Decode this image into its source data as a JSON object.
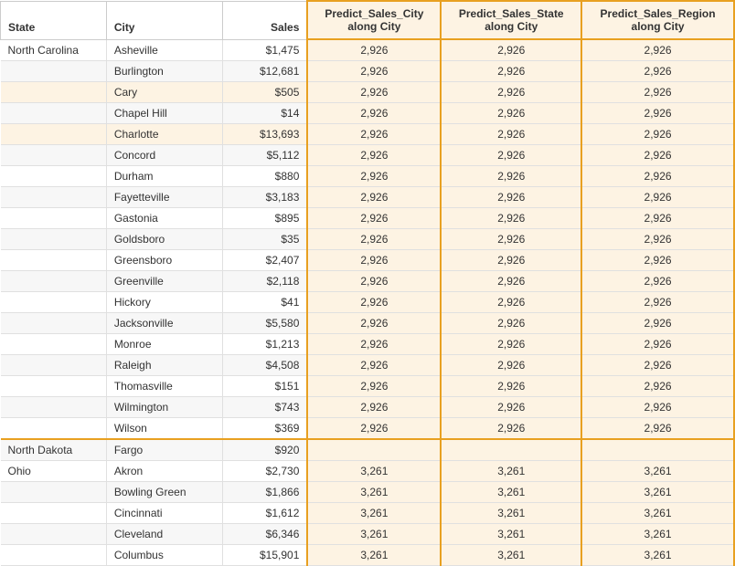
{
  "columns": [
    {
      "key": "state",
      "label": "State"
    },
    {
      "key": "city",
      "label": "City"
    },
    {
      "key": "sales",
      "label": "Sales"
    },
    {
      "key": "predict_city",
      "label": "Predict_Sales_City\nalong City"
    },
    {
      "key": "predict_state",
      "label": "Predict_Sales_State\nalong City"
    },
    {
      "key": "predict_region",
      "label": "Predict_Sales_Region\nalong City"
    }
  ],
  "rows": [
    {
      "state": "North Carolina",
      "city": "Asheville",
      "sales": "$1,475",
      "predict_city": "2,926",
      "predict_state": "2,926",
      "predict_region": "2,926",
      "group": "NC",
      "first": true
    },
    {
      "state": "",
      "city": "Burlington",
      "sales": "$12,681",
      "predict_city": "2,926",
      "predict_state": "2,926",
      "predict_region": "2,926",
      "group": "NC"
    },
    {
      "state": "",
      "city": "Cary",
      "sales": "$505",
      "predict_city": "2,926",
      "predict_state": "2,926",
      "predict_region": "2,926",
      "group": "NC",
      "highlight": true
    },
    {
      "state": "",
      "city": "Chapel Hill",
      "sales": "$14",
      "predict_city": "2,926",
      "predict_state": "2,926",
      "predict_region": "2,926",
      "group": "NC"
    },
    {
      "state": "",
      "city": "Charlotte",
      "sales": "$13,693",
      "predict_city": "2,926",
      "predict_state": "2,926",
      "predict_region": "2,926",
      "group": "NC",
      "highlight": true
    },
    {
      "state": "",
      "city": "Concord",
      "sales": "$5,112",
      "predict_city": "2,926",
      "predict_state": "2,926",
      "predict_region": "2,926",
      "group": "NC"
    },
    {
      "state": "",
      "city": "Durham",
      "sales": "$880",
      "predict_city": "2,926",
      "predict_state": "2,926",
      "predict_region": "2,926",
      "group": "NC"
    },
    {
      "state": "",
      "city": "Fayetteville",
      "sales": "$3,183",
      "predict_city": "2,926",
      "predict_state": "2,926",
      "predict_region": "2,926",
      "group": "NC"
    },
    {
      "state": "",
      "city": "Gastonia",
      "sales": "$895",
      "predict_city": "2,926",
      "predict_state": "2,926",
      "predict_region": "2,926",
      "group": "NC"
    },
    {
      "state": "",
      "city": "Goldsboro",
      "sales": "$35",
      "predict_city": "2,926",
      "predict_state": "2,926",
      "predict_region": "2,926",
      "group": "NC"
    },
    {
      "state": "",
      "city": "Greensboro",
      "sales": "$2,407",
      "predict_city": "2,926",
      "predict_state": "2,926",
      "predict_region": "2,926",
      "group": "NC"
    },
    {
      "state": "",
      "city": "Greenville",
      "sales": "$2,118",
      "predict_city": "2,926",
      "predict_state": "2,926",
      "predict_region": "2,926",
      "group": "NC"
    },
    {
      "state": "",
      "city": "Hickory",
      "sales": "$41",
      "predict_city": "2,926",
      "predict_state": "2,926",
      "predict_region": "2,926",
      "group": "NC"
    },
    {
      "state": "",
      "city": "Jacksonville",
      "sales": "$5,580",
      "predict_city": "2,926",
      "predict_state": "2,926",
      "predict_region": "2,926",
      "group": "NC"
    },
    {
      "state": "",
      "city": "Monroe",
      "sales": "$1,213",
      "predict_city": "2,926",
      "predict_state": "2,926",
      "predict_region": "2,926",
      "group": "NC"
    },
    {
      "state": "",
      "city": "Raleigh",
      "sales": "$4,508",
      "predict_city": "2,926",
      "predict_state": "2,926",
      "predict_region": "2,926",
      "group": "NC"
    },
    {
      "state": "",
      "city": "Thomasville",
      "sales": "$151",
      "predict_city": "2,926",
      "predict_state": "2,926",
      "predict_region": "2,926",
      "group": "NC"
    },
    {
      "state": "",
      "city": "Wilmington",
      "sales": "$743",
      "predict_city": "2,926",
      "predict_state": "2,926",
      "predict_region": "2,926",
      "group": "NC"
    },
    {
      "state": "",
      "city": "Wilson",
      "sales": "$369",
      "predict_city": "2,926",
      "predict_state": "2,926",
      "predict_region": "2,926",
      "group": "NC",
      "last": true
    },
    {
      "state": "North Dakota",
      "city": "Fargo",
      "sales": "$920",
      "predict_city": "",
      "predict_state": "",
      "predict_region": "",
      "group": "ND"
    },
    {
      "state": "Ohio",
      "city": "Akron",
      "sales": "$2,730",
      "predict_city": "3,261",
      "predict_state": "3,261",
      "predict_region": "3,261",
      "group": "OH"
    },
    {
      "state": "",
      "city": "Bowling Green",
      "sales": "$1,866",
      "predict_city": "3,261",
      "predict_state": "3,261",
      "predict_region": "3,261",
      "group": "OH"
    },
    {
      "state": "",
      "city": "Cincinnati",
      "sales": "$1,612",
      "predict_city": "3,261",
      "predict_state": "3,261",
      "predict_region": "3,261",
      "group": "OH"
    },
    {
      "state": "",
      "city": "Cleveland",
      "sales": "$6,346",
      "predict_city": "3,261",
      "predict_state": "3,261",
      "predict_region": "3,261",
      "group": "OH"
    },
    {
      "state": "",
      "city": "Columbus",
      "sales": "$15,901",
      "predict_city": "3,261",
      "predict_state": "3,261",
      "predict_region": "3,261",
      "group": "OH"
    }
  ]
}
